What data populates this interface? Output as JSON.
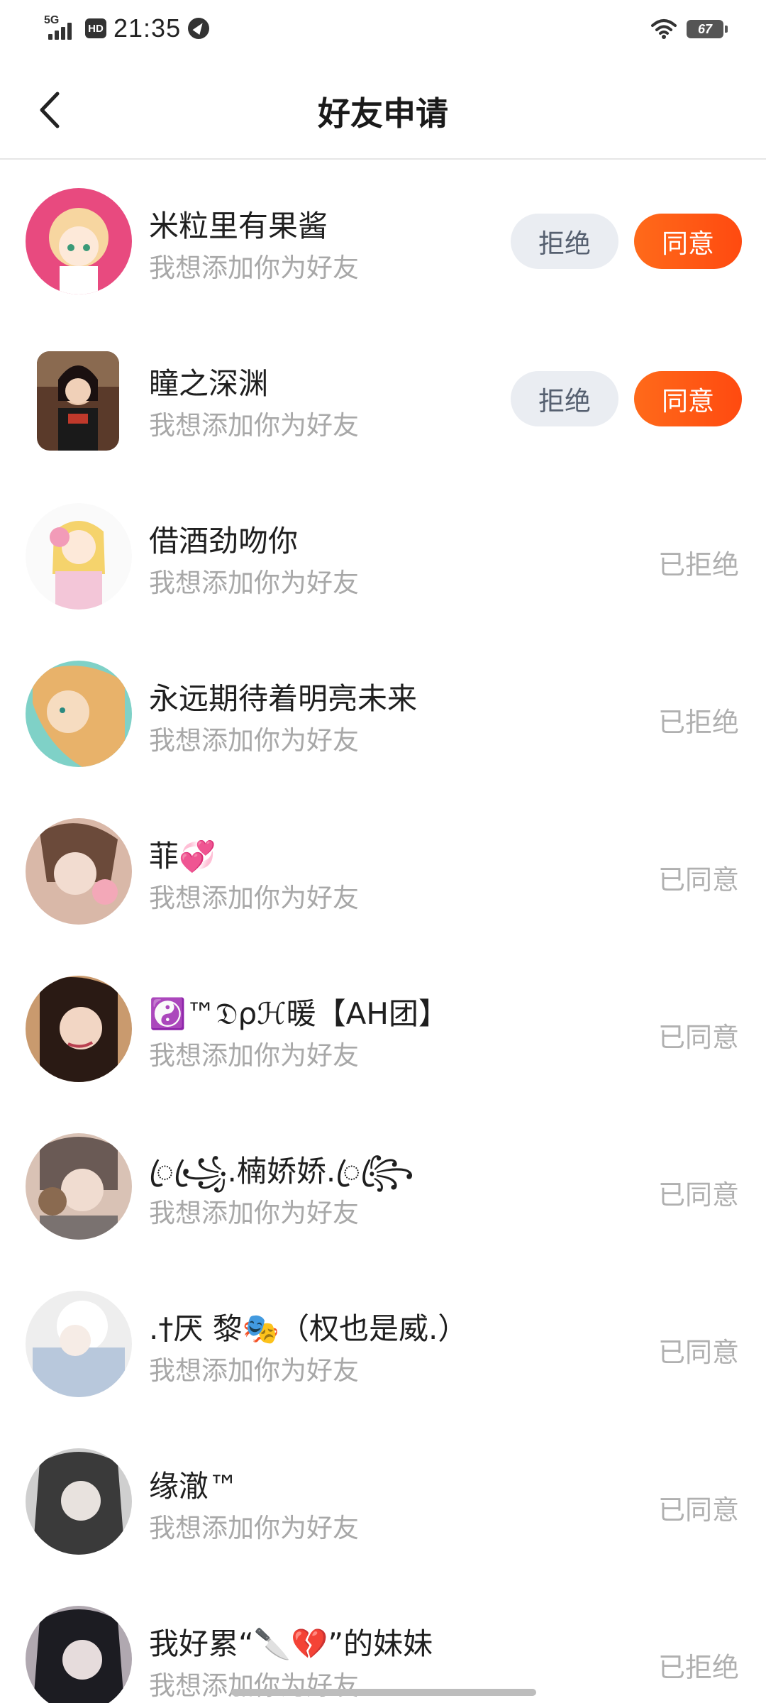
{
  "status_bar": {
    "network": "5G",
    "hd": "HD",
    "time": "21:35",
    "battery": "67"
  },
  "header": {
    "title": "好友申请"
  },
  "requests": [
    {
      "name": "米粒里有果酱",
      "message": "我想添加你为好友",
      "reject_label": "拒绝",
      "accept_label": "同意",
      "avatar_colors": [
        "#e84a7f",
        "#f7d6a0"
      ]
    },
    {
      "name": "瞳之深渊",
      "message": "我想添加你为好友",
      "reject_label": "拒绝",
      "accept_label": "同意",
      "avatar_colors": [
        "#5a3a2a",
        "#c0392b"
      ]
    },
    {
      "name": "借酒劲吻你",
      "message": "我想添加你为好友",
      "status": "已拒绝",
      "avatar_colors": [
        "#f3c6d8",
        "#f5d36c"
      ]
    },
    {
      "name": "永远期待着明亮未来",
      "message": "我想添加你为好友",
      "status": "已拒绝",
      "avatar_colors": [
        "#e8b26a",
        "#7fd1c7"
      ]
    },
    {
      "name": "菲💞",
      "message": "我想添加你为好友",
      "status": "已同意",
      "avatar_colors": [
        "#d9b8a8",
        "#6b4a3a"
      ]
    },
    {
      "name": "☯️™𝔇ρℋ暖【AH团】",
      "message": "我想添加你为好友",
      "status": "已同意",
      "avatar_colors": [
        "#2a1a14",
        "#c99a6e"
      ]
    },
    {
      "name": "ꦿ꧁ꦿ.楠娇娇.ꦿ꧂ꦿ",
      "message": "我想添加你为好友",
      "status": "已同意",
      "avatar_colors": [
        "#6a5a55",
        "#d9c2b5"
      ]
    },
    {
      "name": ".†厌 黎🎭（权也是威.）",
      "message": "我想添加你为好友",
      "status": "已同意",
      "avatar_colors": [
        "#b8c8dc",
        "#eeeeee"
      ]
    },
    {
      "name": "缘澈™",
      "message": "我想添加你为好友",
      "status": "已同意",
      "avatar_colors": [
        "#3a3a3a",
        "#cfcfcf"
      ]
    },
    {
      "name": "我好累“🔪💔”的妹妹",
      "message": "我想添加你为好友",
      "status": "已拒绝",
      "avatar_colors": [
        "#1c1c22",
        "#b0a8b0"
      ]
    }
  ]
}
